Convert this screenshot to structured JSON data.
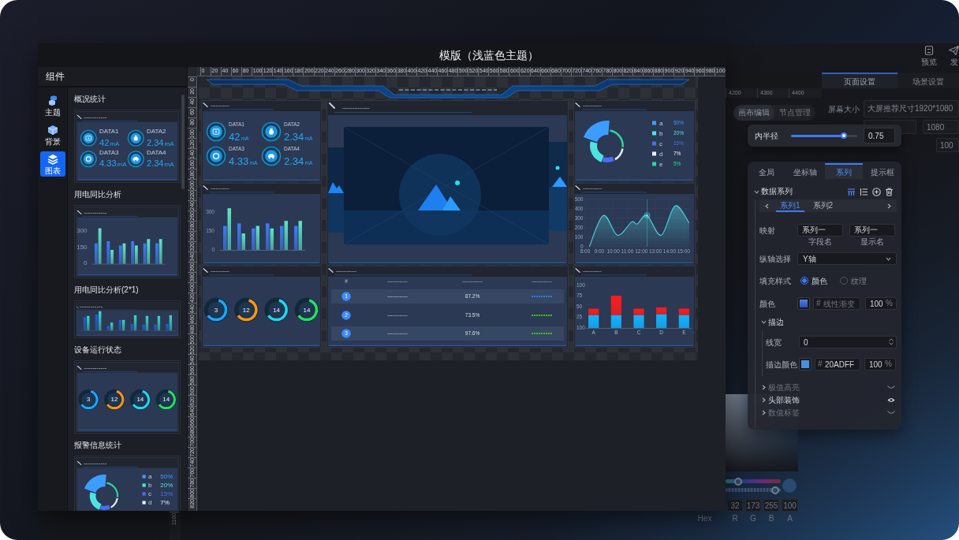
{
  "window": {
    "title": "模版（浅蓝色主题）"
  },
  "component_panel": {
    "title": "组件",
    "nav": [
      {
        "label": "主题",
        "selected": false
      },
      {
        "label": "背景",
        "selected": false
      },
      {
        "label": "图表",
        "selected": true
      }
    ],
    "components": [
      {
        "title": "概况统计",
        "preview": {
          "kind": "stats",
          "title": "-----------",
          "items": [
            {
              "label": "DATA1",
              "value": "42",
              "unit": "mA"
            },
            {
              "label": "DATA2",
              "value": "2.34",
              "unit": "mA"
            },
            {
              "label": "DATA3",
              "value": "4.33",
              "unit": "mA"
            },
            {
              "label": "DATA4",
              "value": "2.34",
              "unit": "mA"
            }
          ]
        }
      },
      {
        "title": "用电同比分析",
        "preview": {
          "kind": "bars",
          "title": "-----------",
          "chart_data": {
            "type": "bar",
            "ylim": [
              0,
              330
            ],
            "yticks": [
              0,
              150,
              300
            ],
            "series": [
              {
                "color": "#3d7cf5",
                "values": [
                  190,
                  210,
                  170,
                  210,
                  190,
                  190
                ]
              },
              {
                "color": "#5fe3c4",
                "values": [
                  330,
                  130,
                  190,
                  170,
                  230,
                  230
                ]
              }
            ]
          }
        }
      },
      {
        "title": "用电同比分析(2*1)",
        "preview": {
          "kind": "wide_bars",
          "title": "-----------"
        }
      },
      {
        "title": "设备运行状态",
        "preview": {
          "kind": "gauges",
          "title": "-----------",
          "items": [
            {
              "value": "3",
              "color": "#1aa6ff"
            },
            {
              "value": "12",
              "color": "#ff9416"
            },
            {
              "value": "14",
              "color": "#1fd8ee"
            },
            {
              "value": "14",
              "color": "#23e05e"
            }
          ]
        }
      },
      {
        "title": "报警信息统计",
        "preview": {
          "kind": "donut",
          "title": "-----------",
          "legend": [
            {
              "label": "a",
              "value": "50%",
              "color": "#3d9dff"
            },
            {
              "label": "b",
              "value": "20%",
              "color": "#4de3e0"
            },
            {
              "label": "c",
              "value": "15%",
              "color": "#4b6ef0"
            },
            {
              "label": "d",
              "value": "7%",
              "color": "#e6eefc"
            }
          ]
        }
      }
    ]
  },
  "canvas": {
    "top_ruler": [
      "0",
      "20",
      "40",
      "60",
      "80",
      "100",
      "120",
      "140",
      "160",
      "180",
      "200",
      "220",
      "240",
      "260",
      "280",
      "300",
      "320",
      "340",
      "360",
      "380",
      "400",
      "420",
      "440",
      "460",
      "480",
      "500",
      "520",
      "540",
      "560",
      "580",
      "600",
      "620",
      "640",
      "660",
      "680",
      "700",
      "720",
      "740",
      "760",
      "780",
      "800",
      "820",
      "840",
      "860",
      "880",
      "900",
      "920",
      "940",
      "960",
      "980",
      "100"
    ],
    "left_ruler": [
      "0",
      "20",
      "40",
      "60",
      "80",
      "100",
      "120",
      "140",
      "160",
      "180",
      "200",
      "220",
      "240",
      "260",
      "280",
      "300",
      "320",
      "340",
      "360",
      "380",
      "400",
      "420",
      "440",
      "460",
      "480",
      "500",
      "520",
      "540",
      "560",
      "580",
      "600",
      "620",
      "640",
      "660",
      "680",
      "700",
      "720",
      "740",
      "760",
      "780",
      "800",
      "820"
    ],
    "widgets": [
      {
        "kind": "stats",
        "title": "-----------",
        "items": [
          {
            "label": "DATA1",
            "value": "42",
            "unit": "mA"
          },
          {
            "label": "DATA2",
            "value": "2.34",
            "unit": "mA"
          },
          {
            "label": "DATA3",
            "value": "4.33",
            "unit": "mA"
          },
          {
            "label": "DATA4",
            "value": "2.34",
            "unit": "mA"
          }
        ]
      },
      {
        "kind": "image",
        "title": "----------------"
      },
      {
        "kind": "donut",
        "title": "-----------",
        "legend": [
          {
            "label": "a",
            "value": "50%",
            "color": "#3d9dff"
          },
          {
            "label": "b",
            "value": "20%",
            "color": "#4de3e0"
          },
          {
            "label": "c",
            "value": "15%",
            "color": "#4b6ef0"
          },
          {
            "label": "d",
            "value": "7%",
            "color": "#e6eefc"
          },
          {
            "label": "e",
            "value": "5%",
            "color": "#2fd69c"
          }
        ]
      },
      {
        "kind": "bars",
        "title": "-----------",
        "chart_data": {
          "type": "bar",
          "ylim": [
            0,
            330
          ],
          "yticks": [
            0,
            150,
            300
          ],
          "series": [
            {
              "color": "#3d7cf5",
              "values": [
                190,
                210,
                170,
                210,
                190,
                190
              ]
            },
            {
              "color": "#5fe3c4",
              "values": [
                330,
                130,
                190,
                170,
                230,
                230
              ]
            }
          ]
        }
      },
      {
        "kind": "line",
        "title": "-----------",
        "chart_data": {
          "type": "area",
          "x": [
            8.3,
            9.3,
            10.3,
            11.3,
            11.7,
            12.4,
            13.4,
            14.4,
            15.4
          ],
          "series": [
            {
              "color": "#52d6e0",
              "values": [
                0,
                330,
                120,
                260,
                240,
                330,
                120,
                430,
                250
              ]
            }
          ],
          "xlim": [
            8,
            15.4
          ],
          "ylim": [
            0,
            500
          ],
          "xticks": [
            {
              "value": 8,
              "label": "8:00"
            },
            {
              "value": 9,
              "label": "9:00"
            },
            {
              "value": 10,
              "label": "10:00"
            },
            {
              "value": 11,
              "label": "11:00"
            },
            {
              "value": 12,
              "label": "12:00"
            },
            {
              "value": 13,
              "label": "13:00"
            },
            {
              "value": 14,
              "label": "14:00"
            },
            {
              "value": 15,
              "label": "15:00"
            }
          ],
          "yticks": [
            0,
            100,
            200,
            300,
            400,
            500
          ],
          "grid": true,
          "ref_lines": [
            {
              "axis": "x",
              "value": 12.4
            }
          ]
        }
      },
      {
        "kind": "gauges",
        "title": "-----------",
        "items": [
          {
            "value": "3",
            "color": "#1aa6ff"
          },
          {
            "value": "12",
            "color": "#ff9416"
          },
          {
            "value": "14",
            "color": "#1fd8ee"
          },
          {
            "value": "14",
            "color": "#23e05e"
          }
        ]
      },
      {
        "kind": "table",
        "title": "------------",
        "columns": [
          "#",
          "------------",
          "------------",
          "------------"
        ],
        "rows": [
          {
            "cells": [
              "1",
              "------------",
              "87.2%"
            ],
            "color": "#2f7cf6"
          },
          {
            "cells": [
              "2",
              "------------",
              "73.5%"
            ],
            "color": "#43c21c"
          },
          {
            "cells": [
              "3",
              "------------",
              "97.6%"
            ],
            "color": "#43c21c"
          }
        ]
      },
      {
        "kind": "stacked_bars",
        "title": "-----------",
        "baseline_label": "100",
        "chart_data": {
          "type": "bar",
          "stacked": true,
          "categories": [
            "A",
            "B",
            "C",
            "D",
            "E"
          ],
          "ylim": [
            0,
            100
          ],
          "yticks": [
            25,
            50,
            75,
            100
          ],
          "series": [
            {
              "color": "#12b5ff",
              "values": [
                30,
                30,
                30,
                32,
                30
              ]
            },
            {
              "color": "#ff1c1c",
              "values": [
                15,
                45,
                15,
                16,
                15
              ]
            }
          ]
        }
      }
    ]
  },
  "background_window": {
    "toolbar": [
      {
        "label": "预览"
      },
      {
        "label": "发"
      }
    ],
    "tabs": [
      {
        "label": "页面设置",
        "selected": true
      },
      {
        "label": "场景设置",
        "selected": false
      }
    ],
    "ruler": [
      "4200",
      "4300",
      "4400"
    ],
    "modes": [
      {
        "label": "画布编辑",
        "selected": true
      },
      {
        "label": "节点管理",
        "selected": false
      }
    ],
    "screen_size": {
      "label": "屏幕大小",
      "value": "大屏推荐尺寸1920*1080"
    },
    "height": {
      "value": "1080"
    },
    "opacity": {
      "value": "100"
    },
    "bottom_ruler": [
      "1100"
    ]
  },
  "radius_popover": {
    "label": "内半径",
    "level": 0.8,
    "value": "0.75"
  },
  "series_panel": {
    "tabs": [
      {
        "label": "全局",
        "selected": false
      },
      {
        "label": "坐标轴",
        "selected": false
      },
      {
        "label": "系列",
        "selected": true
      },
      {
        "label": "提示框",
        "selected": false
      }
    ],
    "data_series": {
      "label": "数据系列",
      "expanded": true
    },
    "series_tabs": [
      {
        "label": "系列1",
        "selected": true
      },
      {
        "label": "系列2",
        "selected": false
      }
    ],
    "mapping": {
      "label": "映射",
      "fields": [
        {
          "value": "系列一",
          "caption": "字段名"
        },
        {
          "value": "系列一",
          "caption": "显示名"
        }
      ]
    },
    "axis": {
      "label": "纵轴选择",
      "value": "Y轴"
    },
    "fill": {
      "label": "填充样式",
      "options": [
        {
          "label": "颜色",
          "selected": true
        },
        {
          "label": "纹理",
          "selected": false
        }
      ]
    },
    "color": {
      "label": "颜色",
      "prefix": "#",
      "placeholder": "线性渐变",
      "opacity": "100",
      "unit": "%"
    },
    "stroke": {
      "label": "描边",
      "expanded": true,
      "width": {
        "label": "线宽",
        "value": "0"
      },
      "color": {
        "label": "描边颜色",
        "prefix": "#",
        "value": "20ADFF",
        "opacity": "100",
        "unit": "%"
      }
    },
    "groups": [
      {
        "label": "极值高亮",
        "expanded": false,
        "visible": false
      },
      {
        "label": "头部装饰",
        "expanded": false,
        "visible": true
      },
      {
        "label": "数值标签",
        "expanded": false,
        "visible": false
      }
    ]
  },
  "color_picker": {
    "hue": {
      "level": 0.23
    },
    "alpha": {
      "level": 0.9
    },
    "values": [
      "32",
      "173",
      "255",
      "100"
    ],
    "labels": [
      "Hex",
      "R",
      "G",
      "B",
      "A"
    ]
  }
}
